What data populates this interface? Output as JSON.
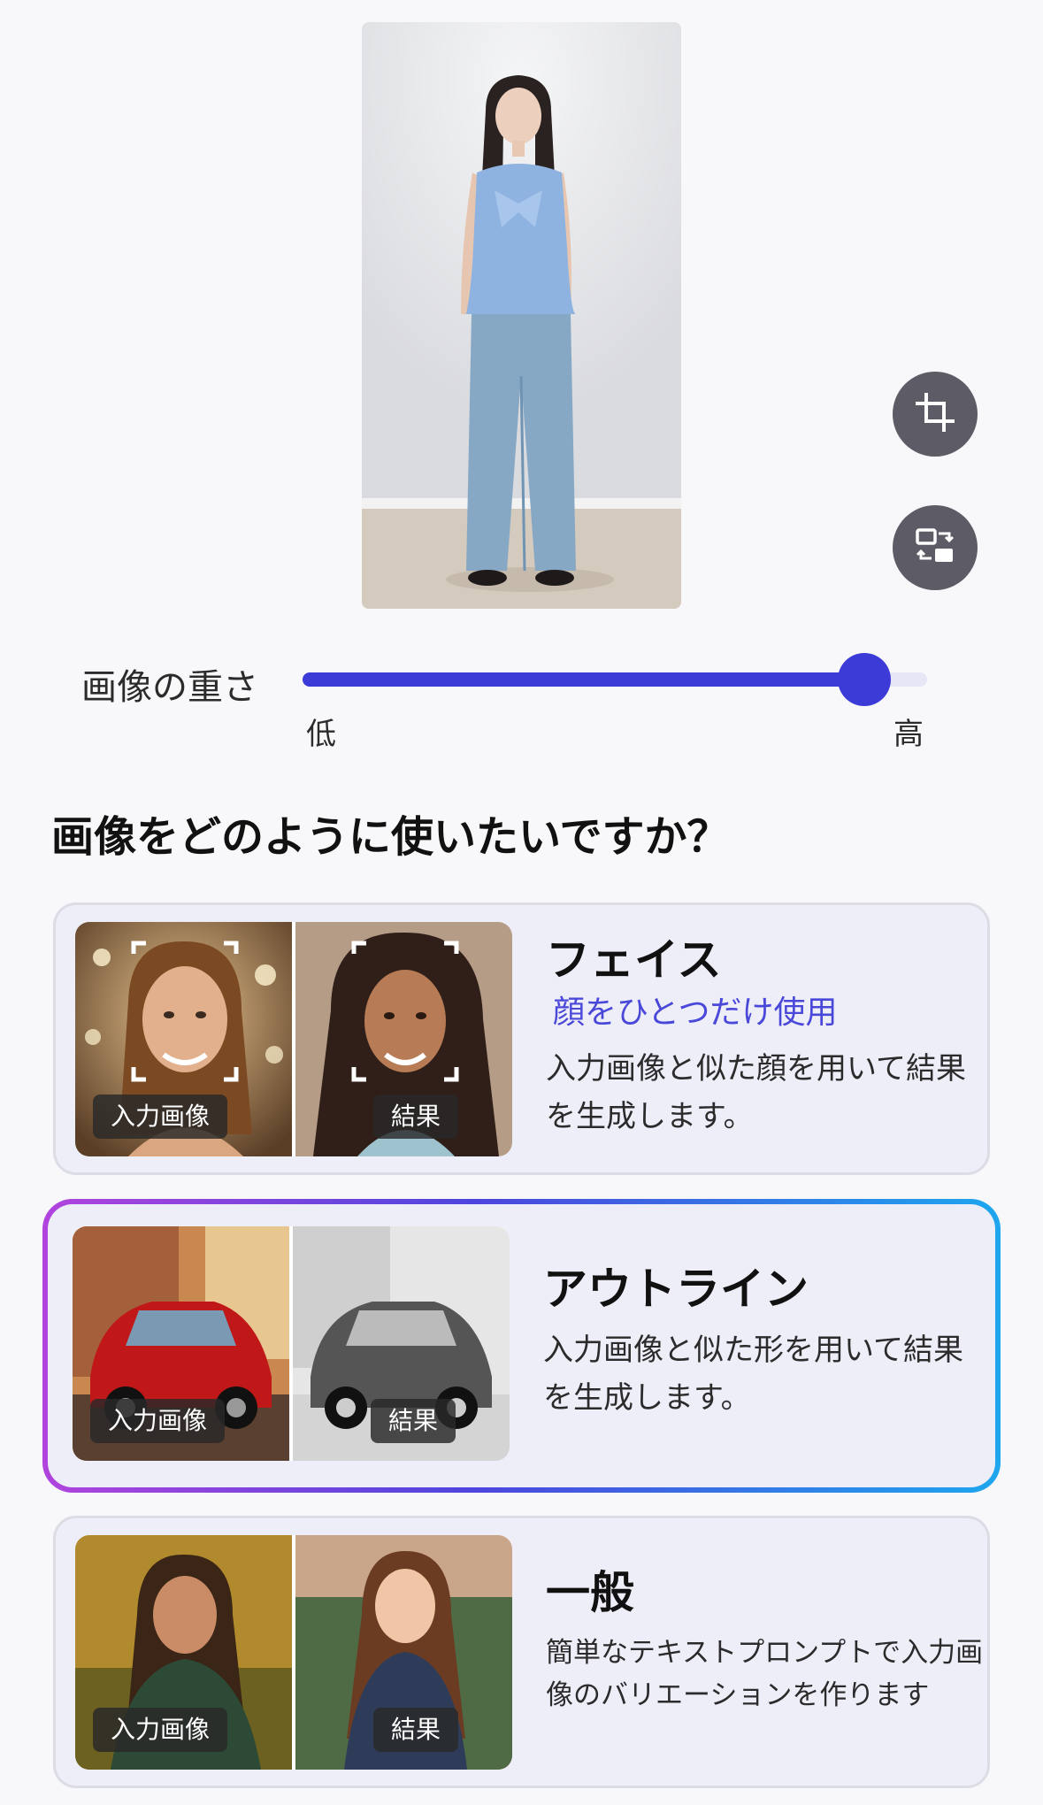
{
  "preview": {
    "image": "uploaded photo of woman in blue top and jeans"
  },
  "tools": {
    "crop_icon": "crop-icon",
    "swap_icon": "swap-image-icon"
  },
  "weight": {
    "label": "画像の重さ",
    "low": "低",
    "high": "高",
    "value": 0.9
  },
  "question": "画像をどのように使いたいですか？",
  "options": [
    {
      "title": "フェイス",
      "subtitle": "顔をひとつだけ使用",
      "description": "入力画像と似た顔を用いて結果を生成します。",
      "input_tag": "入力画像",
      "result_tag": "結果",
      "selected": false
    },
    {
      "title": "アウトライン",
      "description": "入力画像と似た形を用いて結果を生成します。",
      "input_tag": "入力画像",
      "result_tag": "結果",
      "selected": true
    },
    {
      "title": "一般",
      "description": "簡単なテキストプロンプトで入力画像のバリエーションを作ります",
      "input_tag": "入力画像",
      "result_tag": "結果",
      "selected": false
    }
  ],
  "colors": {
    "accent": "#3d3bd7",
    "track": "#e6e6f7",
    "card_bg": "#eeeef9",
    "fab": "#5c5b66"
  }
}
